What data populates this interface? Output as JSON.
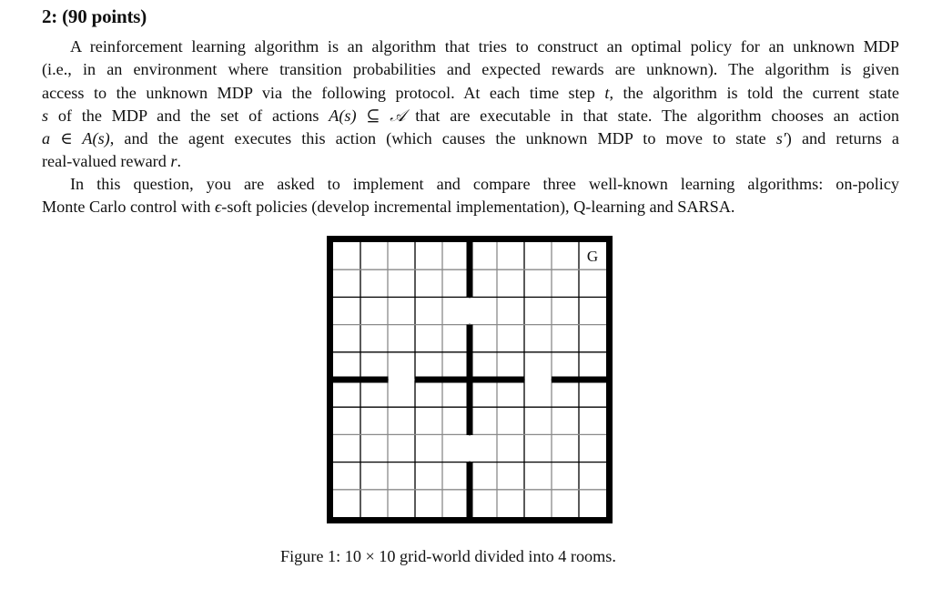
{
  "problem": {
    "heading": "2: (90 points)",
    "paragraph1_lines": [
      [
        "A reinforcement learning algorithm is an algorithm that tries to construct an optimal policy for an unknown MDP"
      ],
      [
        "(i.e., in an environment where transition probabilities and expected rewards are unknown). The algorithm is given"
      ],
      [
        "access to the unknown MDP via the following protocol. At each time step ",
        {
          "math": "t"
        },
        ", the algorithm is told the current state"
      ],
      [
        {
          "math": "s"
        },
        " of the MDP and the set of actions ",
        {
          "math": "A(s) ⊆ 𝒜"
        },
        " that are executable in that state. The algorithm chooses an action"
      ],
      [
        {
          "math": "a ∈ A(s)"
        },
        ", and the agent executes this action (which causes the unknown MDP to move to state ",
        {
          "math": "s′"
        },
        ") and returns a"
      ],
      [
        "real-valued reward ",
        {
          "math": "r"
        },
        "."
      ]
    ],
    "paragraph2_lines": [
      [
        "In this question, you are asked to implement and compare three well-known learning algorithms: on-policy"
      ],
      [
        "Monte Carlo control with ",
        {
          "math": "ϵ"
        },
        "-soft policies (develop incremental implementation), Q-learning and SARSA."
      ]
    ]
  },
  "figure": {
    "caption": "Figure 1: 10 × 10 grid-world divided into 4 rooms.",
    "grid": {
      "rows": 10,
      "cols": 10,
      "goal_label": "G",
      "goal_cell": {
        "row": 0,
        "col": 9
      },
      "vertical_wall_after_col": 5,
      "vertical_wall_door_rows": [
        2,
        7
      ],
      "horizontal_wall_after_row": 5,
      "horizontal_wall_door_cols": [
        2,
        7
      ],
      "colors": {
        "wall": "#000000",
        "gridline_dark": "#000000",
        "gridline_light": "#8a8a8a",
        "cell": "#ffffff"
      }
    }
  }
}
